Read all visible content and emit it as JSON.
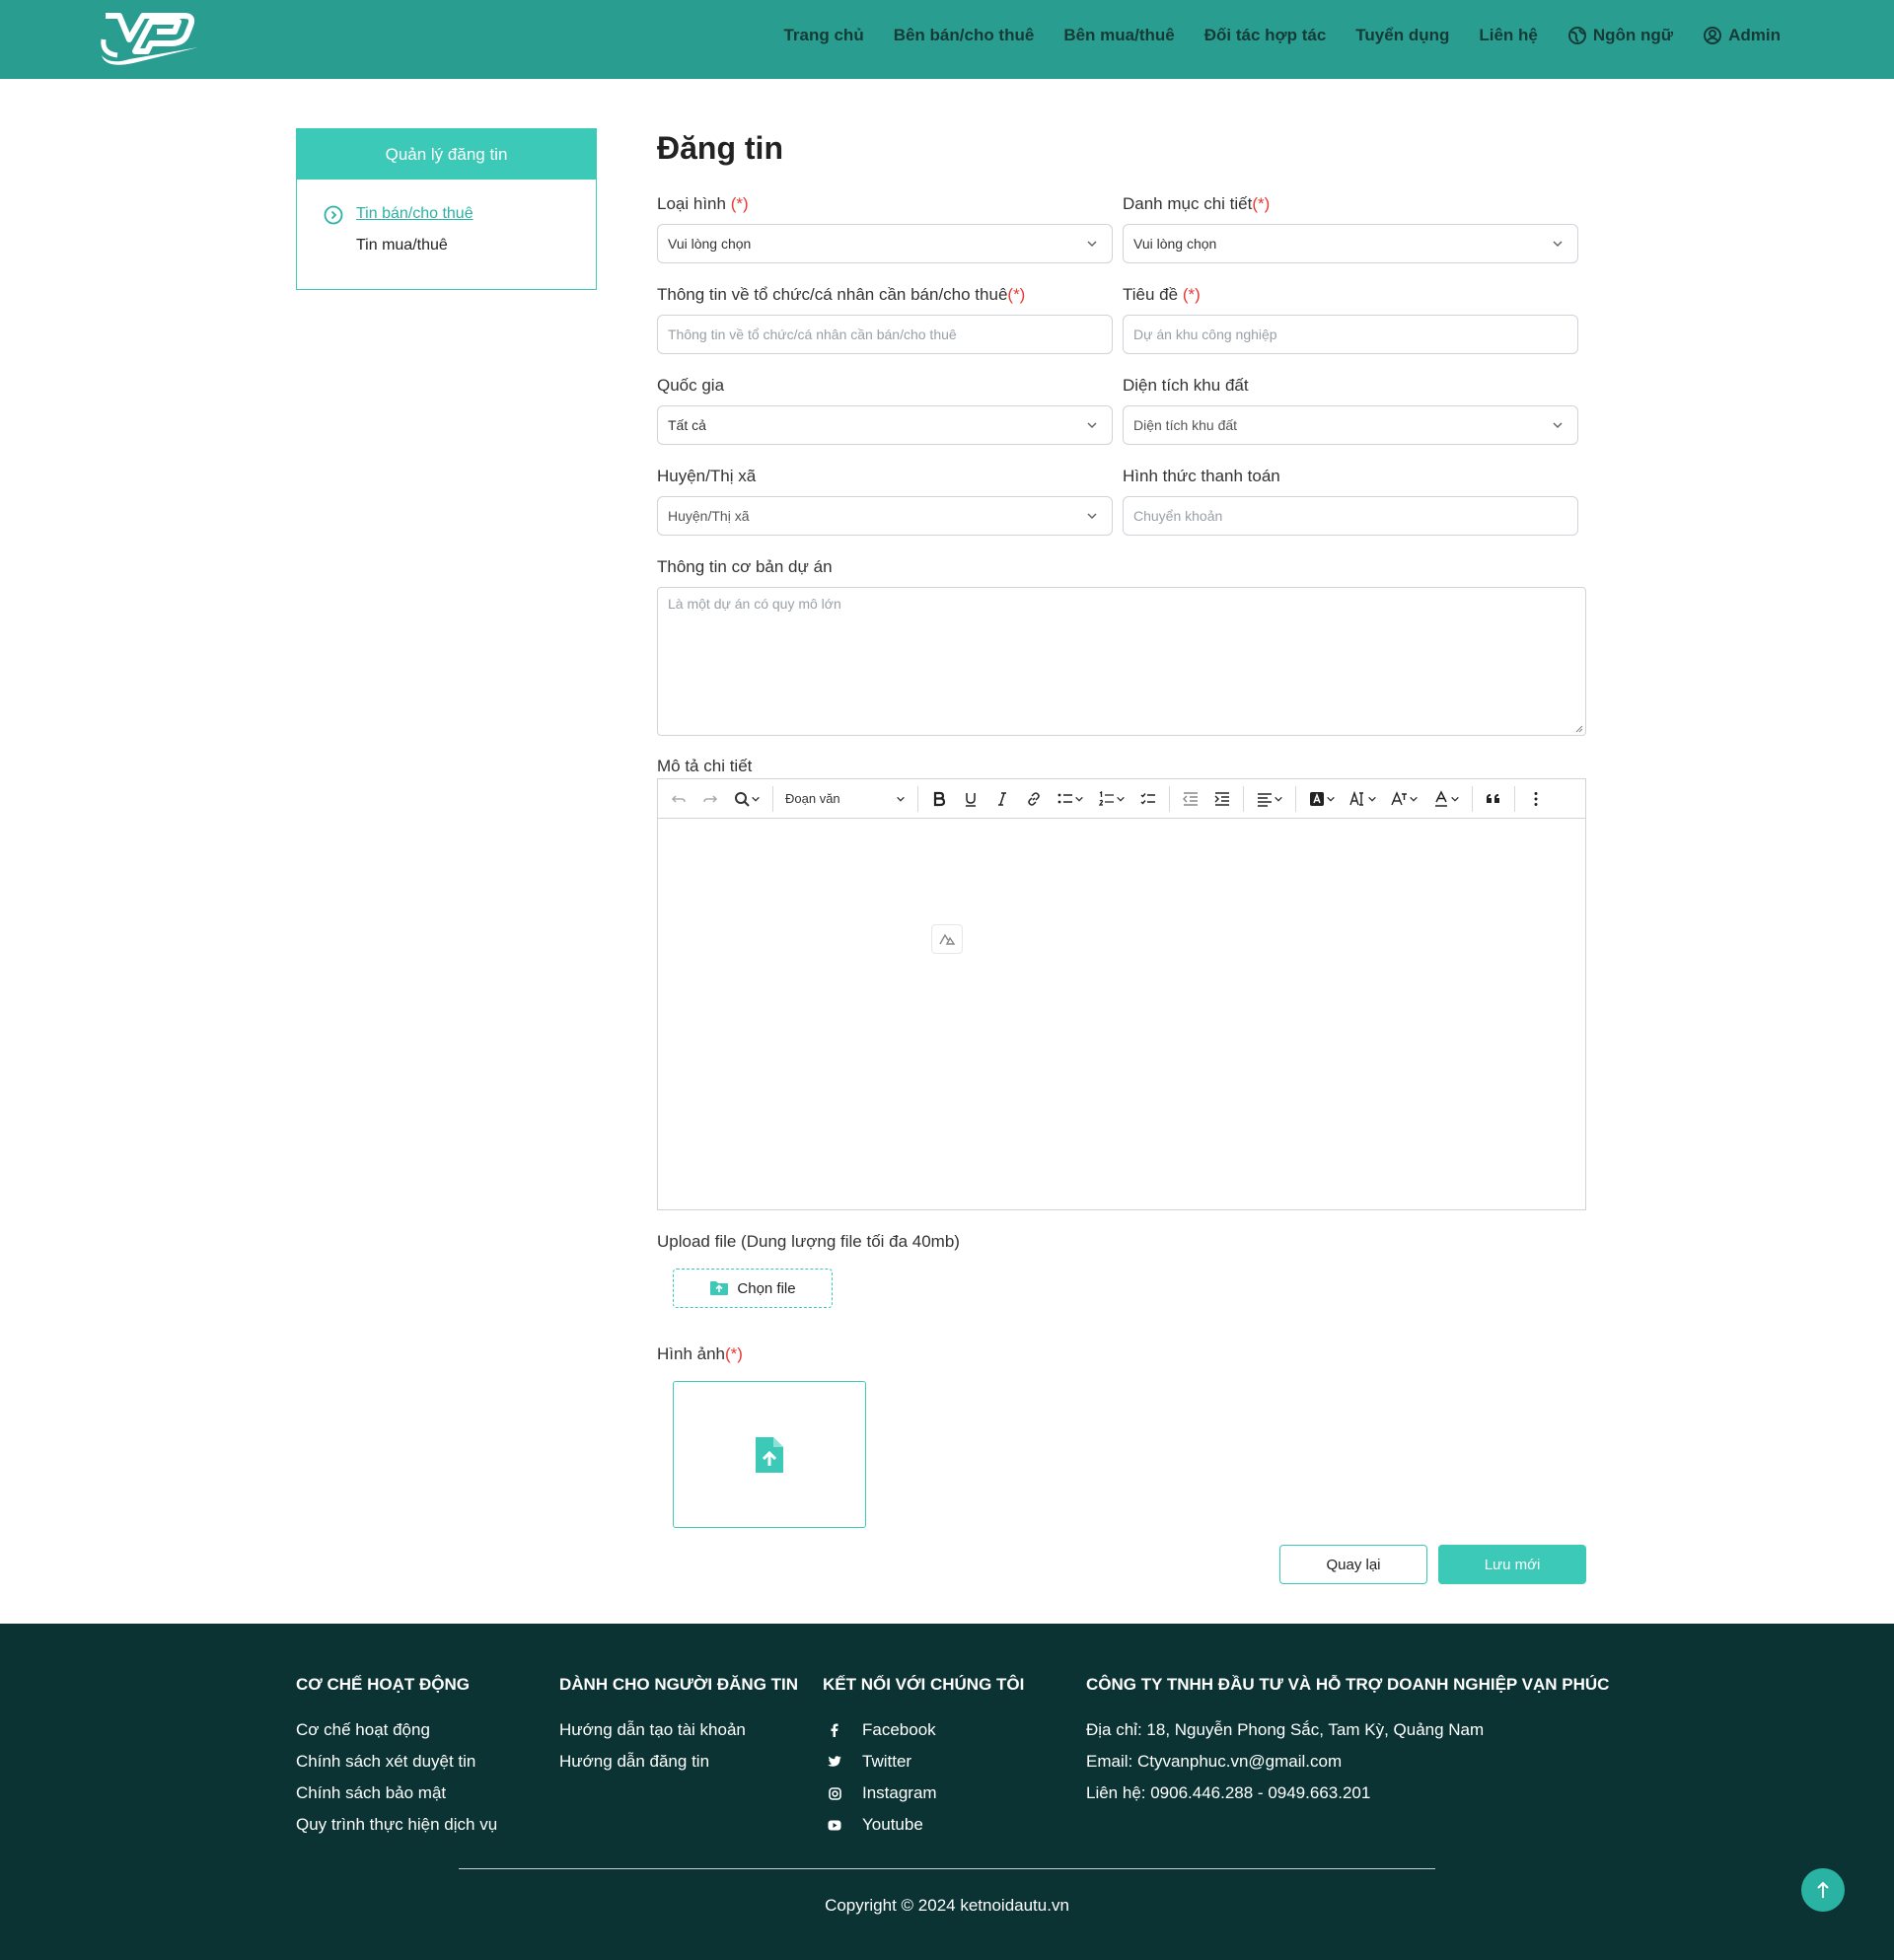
{
  "header": {
    "nav": [
      {
        "label": "Trang chủ"
      },
      {
        "label": "Bên bán/cho thuê"
      },
      {
        "label": "Bên mua/thuê"
      },
      {
        "label": "Đối tác hợp tác"
      },
      {
        "label": "Tuyển dụng"
      },
      {
        "label": "Liên hệ"
      },
      {
        "label": "Ngôn ngữ",
        "icon": "globe-icon"
      },
      {
        "label": "Admin",
        "icon": "user-circle-icon"
      }
    ]
  },
  "sidebar": {
    "title": "Quản lý đăng tin",
    "items": [
      {
        "label": "Tin bán/cho thuê",
        "active": true
      },
      {
        "label": "Tin mua/thuê",
        "active": false
      }
    ]
  },
  "form": {
    "title": "Đăng tin",
    "required_mark": "(*)",
    "loai_hinh": {
      "label": "Loại hình",
      "value": "Vui lòng chọn"
    },
    "danh_muc": {
      "label": "Danh mục chi tiết",
      "value": "Vui lòng chọn"
    },
    "thong_tin_to_chuc": {
      "label": "Thông tin về tổ chức/cá nhân cần bán/cho thuê",
      "placeholder": "Thông tin về tổ chức/cá nhân cần bán/cho thuê"
    },
    "tieu_de": {
      "label": "Tiêu đề",
      "placeholder": "Dự án khu công nghiệp"
    },
    "quoc_gia": {
      "label": "Quốc gia",
      "value": "Tất cả"
    },
    "dien_tich": {
      "label": "Diện tích khu đất",
      "placeholder": "Diện tích khu đất"
    },
    "huyen": {
      "label": "Huyện/Thị xã",
      "placeholder": "Huyện/Thị xã"
    },
    "thanh_toan": {
      "label": "Hình thức thanh toán",
      "placeholder": "Chuyển khoản"
    },
    "thong_tin_co_ban": {
      "label": "Thông tin cơ bản dự án",
      "placeholder": "Là một dự án có quy mô lớn"
    },
    "mo_ta": {
      "label": "Mô tả chi tiết",
      "paragraph_select": "Đoạn văn"
    },
    "upload": {
      "label": "Upload file (Dung lượng file tối đa 40mb)",
      "button": "Chọn file"
    },
    "hinh_anh": {
      "label": "Hình ảnh"
    },
    "back_button": "Quay lại",
    "save_button": "Lưu mới"
  },
  "footer": {
    "col1": {
      "title": "CƠ CHẾ HOẠT ĐỘNG",
      "links": [
        "Cơ chế hoạt động",
        "Chính sách xét duyệt tin",
        "Chính sách bảo mật",
        "Quy trình thực hiện dịch vụ"
      ]
    },
    "col2": {
      "title": "DÀNH CHO NGƯỜI ĐĂNG TIN",
      "links": [
        "Hướng dẫn tạo tài khoản",
        "Hướng dẫn đăng tin"
      ]
    },
    "col3": {
      "title": "KẾT NỐI VỚI CHÚNG TÔI",
      "links": [
        "Facebook",
        "Twitter",
        "Instagram",
        "Youtube"
      ]
    },
    "col4": {
      "title": "CÔNG TY TNHH ĐẦU TƯ VÀ HỖ TRỢ DOANH NGHIỆP VẠN PHÚC",
      "lines": [
        "Địa chỉ: 18, Nguyễn Phong Sắc, Tam Kỳ, Quảng Nam",
        "Email: Ctyvanphuc.vn@gmail.com",
        "Liên hệ: 0906.446.288 - 0949.663.201"
      ]
    },
    "copyright": "Copyright © 2024 ketnoidautu.vn"
  },
  "colors": {
    "header": "#2a9d91",
    "accent": "#3cc9b8",
    "footer": "#0b3333",
    "required": "#e53935"
  }
}
